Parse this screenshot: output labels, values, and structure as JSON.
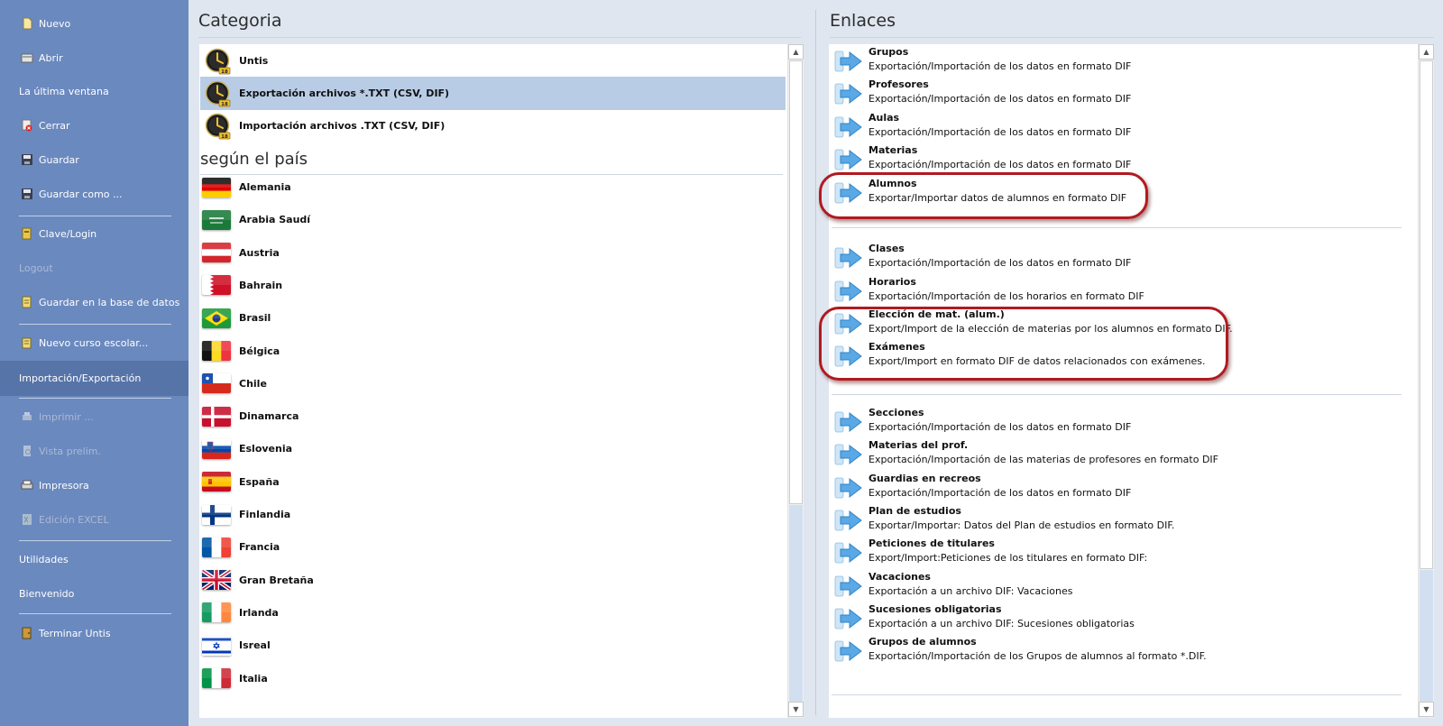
{
  "sidebar": {
    "items": [
      {
        "label": "Nuevo",
        "icon": "new-document-icon"
      },
      {
        "label": "Abrir",
        "icon": "open-folder-icon"
      },
      {
        "label": "La última ventana"
      },
      {
        "label": "Cerrar",
        "icon": "close-document-icon"
      },
      {
        "label": "Guardar",
        "icon": "save-icon"
      },
      {
        "label": "Guardar como ...",
        "icon": "save-as-icon"
      },
      {
        "label": "Clave/Login",
        "icon": "login-icon"
      },
      {
        "label": "Logout",
        "icon": "logout-icon",
        "disabled": true
      },
      {
        "label": "Guardar en la base de datos",
        "icon": "database-save-icon"
      },
      {
        "label": "Nuevo curso escolar...",
        "icon": "new-school-year-icon"
      },
      {
        "label": "Importación/Exportación",
        "active": true
      },
      {
        "label": "Imprimir ...",
        "icon": "print-icon",
        "disabled": true
      },
      {
        "label": "Vista prelim.",
        "icon": "preview-icon",
        "disabled": true
      },
      {
        "label": "Impresora",
        "icon": "printer-icon"
      },
      {
        "label": "Edición EXCEL",
        "icon": "excel-icon",
        "disabled": true
      },
      {
        "label": "Utilidades"
      },
      {
        "label": "Bienvenido"
      },
      {
        "label": "Terminar Untis",
        "icon": "exit-icon"
      }
    ]
  },
  "category": {
    "title": "Categoria",
    "items": [
      {
        "label": "Untis",
        "icon": "untis-clock-icon"
      },
      {
        "label": "Exportación archivos *.TXT (CSV, DIF)",
        "icon": "untis-clock-icon",
        "selected": true
      },
      {
        "label": "Importación archivos .TXT (CSV, DIF)",
        "icon": "untis-clock-icon"
      }
    ],
    "country_title": "según el país",
    "countries": [
      {
        "label": "Alemania",
        "icon": "germany-flag-icon"
      },
      {
        "label": "Arabia Saudí",
        "icon": "saudi-arabia-flag-icon"
      },
      {
        "label": "Austria",
        "icon": "austria-flag-icon"
      },
      {
        "label": "Bahrain",
        "icon": "bahrain-flag-icon"
      },
      {
        "label": "Brasil",
        "icon": "brazil-flag-icon"
      },
      {
        "label": "Bélgica",
        "icon": "belgium-flag-icon"
      },
      {
        "label": "Chile",
        "icon": "chile-flag-icon"
      },
      {
        "label": "Dinamarca",
        "icon": "denmark-flag-icon"
      },
      {
        "label": "Eslovenia",
        "icon": "slovenia-flag-icon"
      },
      {
        "label": "España",
        "icon": "spain-flag-icon"
      },
      {
        "label": "Finlandia",
        "icon": "finland-flag-icon"
      },
      {
        "label": "Francia",
        "icon": "france-flag-icon"
      },
      {
        "label": "Gran Bretaña",
        "icon": "uk-flag-icon"
      },
      {
        "label": "Irlanda",
        "icon": "ireland-flag-icon"
      },
      {
        "label": "Isreal",
        "icon": "israel-flag-icon"
      },
      {
        "label": "Italia",
        "icon": "italy-flag-icon"
      }
    ]
  },
  "links": {
    "title": "Enlaces",
    "items": [
      {
        "title": "Grupos",
        "desc": "Exportación/Importación de los datos en formato DIF"
      },
      {
        "title": "Profesores",
        "desc": "Exportación/Importación de los datos en formato DIF"
      },
      {
        "title": "Aulas",
        "desc": "Exportación/Importación de los datos en formato DIF"
      },
      {
        "title": "Materias",
        "desc": "Exportación/Importación de los datos en formato DIF"
      },
      {
        "title": "Alumnos",
        "desc": "Exportar/Importar datos de alumnos en formato DIF",
        "highlighted": true
      },
      {
        "title": "Clases",
        "desc": "Exportación/Importación de los datos en formato DIF"
      },
      {
        "title": "Horarios",
        "desc": "Exportación/Importación de los horarios en formato DIF"
      },
      {
        "title": "Elección de mat. (alum.)",
        "desc": "Export/Import de la elección de materias por los alumnos en formato DIF.",
        "highlighted": true
      },
      {
        "title": "Exámenes",
        "desc": "Export/Import en formato DIF de datos relacionados con exámenes.",
        "highlighted": true
      },
      {
        "title": "Secciones",
        "desc": "Exportación/Importación de los datos en formato DIF"
      },
      {
        "title": "Materias del prof.",
        "desc": "Exportación/Importación de las materias de profesores en formato DIF"
      },
      {
        "title": "Guardias en recreos",
        "desc": "Exportación/Importación de los datos en formato DIF"
      },
      {
        "title": "Plan de estudios",
        "desc": "Exportar/Importar: Datos del Plan de estudios en formato DIF."
      },
      {
        "title": "Peticiones de titulares",
        "desc": "Export/Import:Peticiones de los titulares en formato DIF:"
      },
      {
        "title": "Vacaciones",
        "desc": "Exportación a un archivo DIF: Vacaciones"
      },
      {
        "title": "Sucesiones obligatorias",
        "desc": "Exportación a un archivo DIF: Sucesiones obligatorias"
      },
      {
        "title": "Grupos de alumnos",
        "desc": "Exportación/Importación de los Grupos de alumnos al formato *.DIF."
      }
    ]
  },
  "colors": {
    "sidebar": "#6a89bf",
    "sidebar_active": "#5774a8",
    "selection": "#b9cce6",
    "highlight_ring": "#b11a20",
    "link_arrow": "#5aa9e6"
  }
}
